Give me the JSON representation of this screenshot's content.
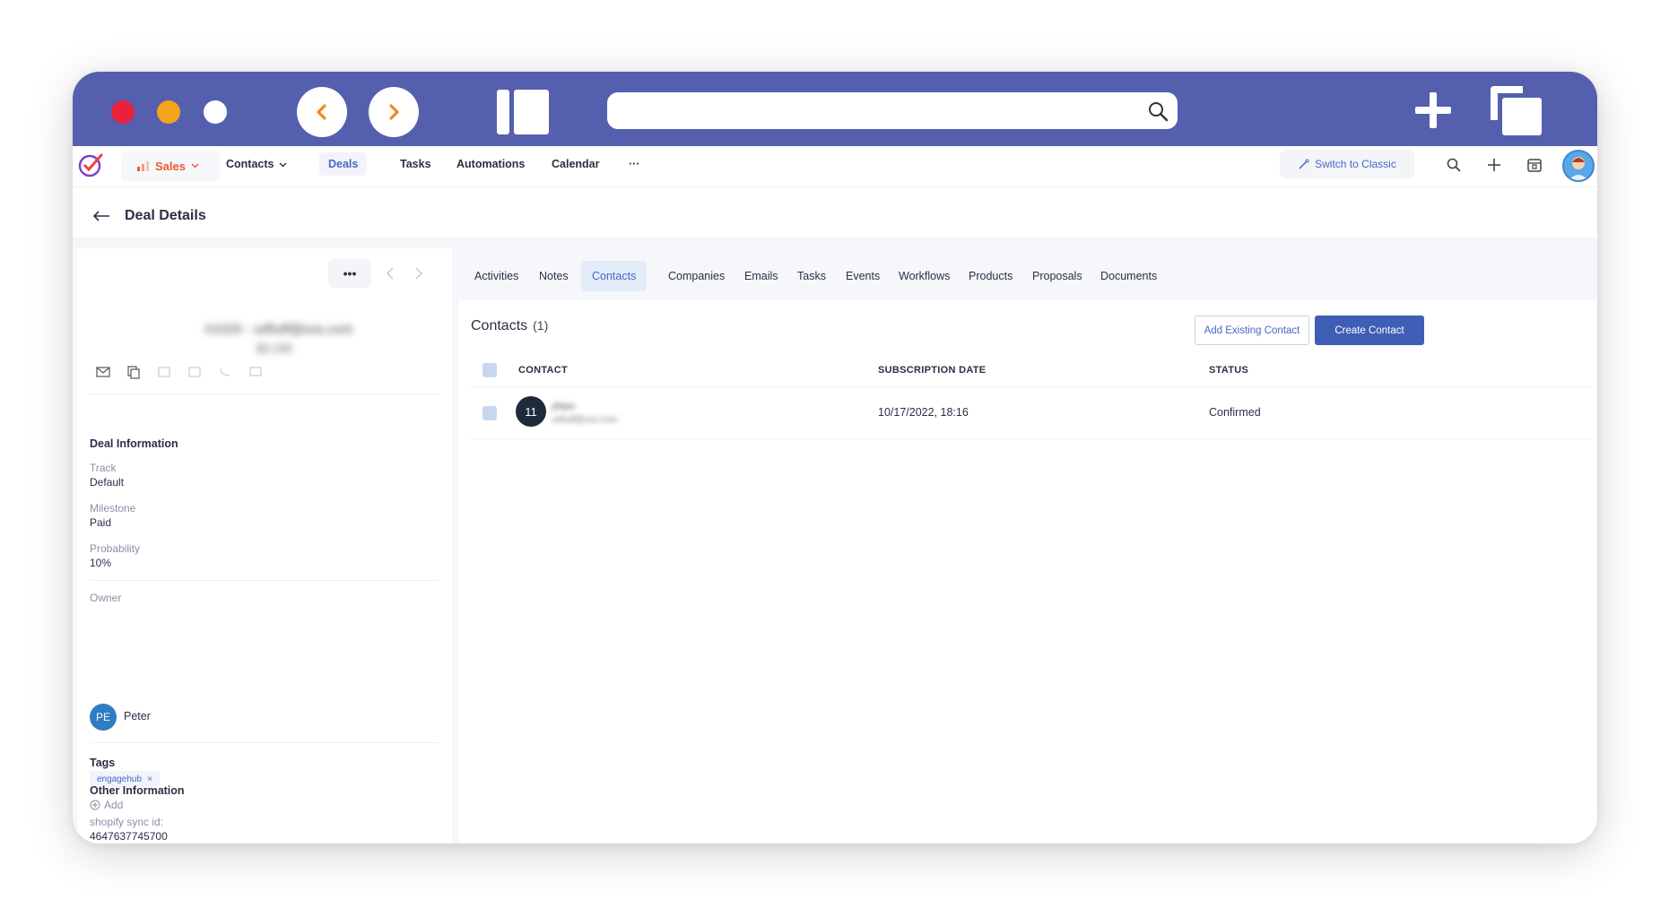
{
  "app": {
    "module": "Sales",
    "nav": [
      "Contacts",
      "Deals",
      "Tasks",
      "Automations",
      "Calendar",
      "···"
    ],
    "active_nav": "Deals",
    "switch_label": "Switch to Classic"
  },
  "page": {
    "title": "Deal Details"
  },
  "deal": {
    "name_blurred": "#1025 - sdfsdf@sss.com",
    "sub_blurred": "$2,100",
    "more_label": "•••",
    "info_title": "Deal Information",
    "fields": [
      {
        "label": "Track",
        "value": "Default"
      },
      {
        "label": "Milestone",
        "value": "Paid"
      },
      {
        "label": "Probability",
        "value": "10%"
      }
    ],
    "owner_label": "Owner",
    "owner_initials": "PE",
    "owner_name": "Peter",
    "tags_title": "Tags",
    "tag": "engagehub",
    "tag_remove": "×",
    "add_label": "Add",
    "other_title": "Other Information",
    "other_field_label": "shopify sync id:",
    "other_field_value": "4647637745700"
  },
  "tabs": [
    "Activities",
    "Notes",
    "Contacts",
    "Companies",
    "Emails",
    "Tasks",
    "Events",
    "Workflows",
    "Products",
    "Proposals",
    "Documents"
  ],
  "active_tab": "Contacts",
  "contacts": {
    "title": "Contacts",
    "count": "(1)",
    "add_existing": "Add Existing Contact",
    "create": "Create Contact",
    "columns": [
      "CONTACT",
      "SUBSCRIPTION DATE",
      "STATUS"
    ],
    "rows": [
      {
        "avatar": "11",
        "name": "zhen",
        "email": "sdfsdf@sss.com",
        "date": "10/17/2022, 18:16",
        "status": "Confirmed"
      }
    ]
  },
  "colors": {
    "chrome": "#5460ae",
    "accent": "#4a67c6",
    "module": "#ee5a32",
    "primary_button": "#3f5eb5"
  }
}
